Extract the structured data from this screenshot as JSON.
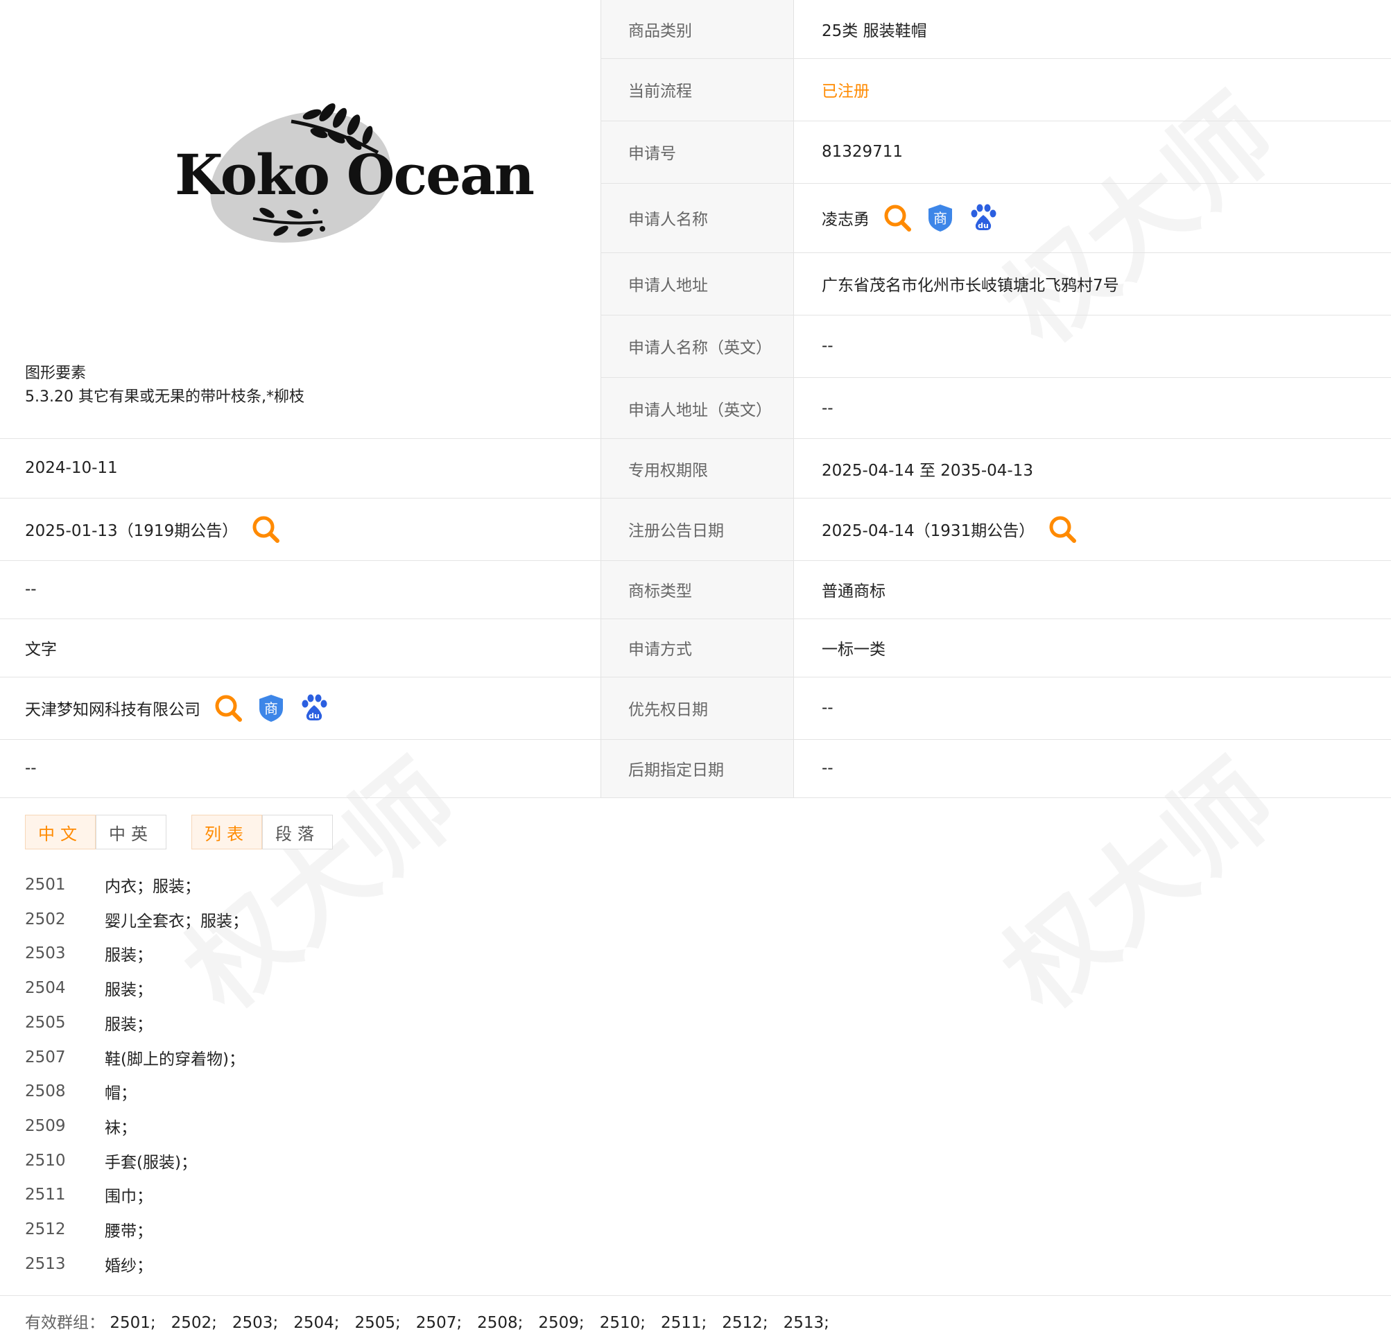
{
  "logo": {
    "text": "Koko Ocean"
  },
  "figure": {
    "label": "图形要素",
    "value": "5.3.20 其它有果或无果的带叶枝条,*柳枝"
  },
  "watermark": "权大师",
  "colors": {
    "accent": "#ff8a00",
    "label_bg": "#f7f7f7",
    "border": "#e4e4e4",
    "shield": "#3d86e8",
    "baidu": "#2b5fe0"
  },
  "right_rows": [
    {
      "label": "商品类别",
      "value": "25类 服装鞋帽"
    },
    {
      "label": "当前流程",
      "value": "已注册"
    },
    {
      "label": "申请号",
      "value": "81329711"
    },
    {
      "label": "申请人名称",
      "value": "凌志勇",
      "icons": [
        "search-icon",
        "shang-shield-icon",
        "baidu-paw-icon"
      ]
    },
    {
      "label": "申请人地址",
      "value": "广东省茂名市化州市长岐镇塘北飞鸦村7号"
    },
    {
      "label": "申请人名称（英文）",
      "value": "--"
    },
    {
      "label": "申请人地址（英文）",
      "value": "--"
    },
    {
      "label": "专用权期限",
      "value": "2025-04-14 至 2035-04-13"
    },
    {
      "label": "注册公告日期",
      "value": "2025-04-14（1931期公告）",
      "icons": [
        "search-icon"
      ]
    },
    {
      "label": "商标类型",
      "value": "普通商标"
    },
    {
      "label": "申请方式",
      "value": "一标一类"
    },
    {
      "label": "优先权日期",
      "value": "--"
    },
    {
      "label": "后期指定日期",
      "value": "--"
    }
  ],
  "left_rows": [
    {
      "value": "2024-10-11"
    },
    {
      "value": "2025-01-13（1919期公告）",
      "icons": [
        "search-icon"
      ]
    },
    {
      "value": "--"
    },
    {
      "value": "文字"
    },
    {
      "value": "天津梦知网科技有限公司",
      "icons": [
        "search-icon",
        "shang-shield-icon",
        "baidu-paw-icon"
      ]
    },
    {
      "value": "--"
    }
  ],
  "tabs": {
    "language": [
      {
        "label": "中文",
        "active": true
      },
      {
        "label": "中英",
        "active": false
      }
    ],
    "view": [
      {
        "label": "列表",
        "active": true
      },
      {
        "label": "段落",
        "active": false
      }
    ]
  },
  "goods": [
    {
      "code": "2501",
      "name": "内衣；服装；"
    },
    {
      "code": "2502",
      "name": "婴儿全套衣；服装；"
    },
    {
      "code": "2503",
      "name": "服装；"
    },
    {
      "code": "2504",
      "name": "服装；"
    },
    {
      "code": "2505",
      "name": "服装；"
    },
    {
      "code": "2507",
      "name": "鞋(脚上的穿着物)；"
    },
    {
      "code": "2508",
      "name": "帽；"
    },
    {
      "code": "2509",
      "name": "袜；"
    },
    {
      "code": "2510",
      "name": "手套(服装)；"
    },
    {
      "code": "2511",
      "name": "围巾；"
    },
    {
      "code": "2512",
      "name": "腰带；"
    },
    {
      "code": "2513",
      "name": "婚纱；"
    }
  ],
  "groups": {
    "label": "有效群组：",
    "values": [
      "2501;",
      "2502;",
      "2503;",
      "2504;",
      "2505;",
      "2507;",
      "2508;",
      "2509;",
      "2510;",
      "2511;",
      "2512;",
      "2513;"
    ]
  }
}
